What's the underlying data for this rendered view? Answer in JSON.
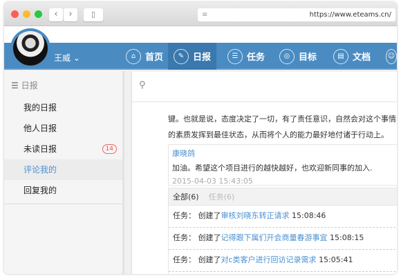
{
  "browser": {
    "url": "https://www.eteams.cn/",
    "back": "‹",
    "forward": "›"
  },
  "user": {
    "name": "王威 ⌄"
  },
  "nav": [
    {
      "label": "首页",
      "icon": "⌂"
    },
    {
      "label": "日报",
      "icon": "✎"
    },
    {
      "label": "任务",
      "icon": "☰"
    },
    {
      "label": "目标",
      "icon": "◎"
    },
    {
      "label": "文档",
      "icon": "▤"
    }
  ],
  "sidebar": {
    "title": "日报",
    "items": [
      {
        "label": "我的日报"
      },
      {
        "label": "他人日报"
      },
      {
        "label": "未读日报",
        "badge": "14"
      },
      {
        "label": "评论我的"
      },
      {
        "label": "回复我的"
      }
    ]
  },
  "main": {
    "search_icon": "⚲",
    "paragraph": [
      "键。也就是说，态度决定了一切，有了责任意识，自然会对这个事情的始末",
      "的素质发挥到最佳状态，从而将个人的能力最好地付诸于行动上。"
    ],
    "comment": {
      "author": "康晓鸽",
      "text": "加油。希望这个项目进行的越快越好，也欢迎新同事的加入.",
      "time": "2015-04-03 15:43:05"
    },
    "feed_tabs": [
      "全部(6)",
      "任务(6)"
    ],
    "feed": [
      {
        "prefix": "任务： 创建了",
        "link": "审核刘晓东转正请求",
        "time": "15:08:46"
      },
      {
        "prefix": "任务： 创建了",
        "link": "记得跟下属们开会商量春游事宜",
        "time": "15:08:15"
      },
      {
        "prefix": "任务： 创建了",
        "link": "对c类客户进行回访记录需求",
        "time": "15:05:41"
      }
    ]
  }
}
